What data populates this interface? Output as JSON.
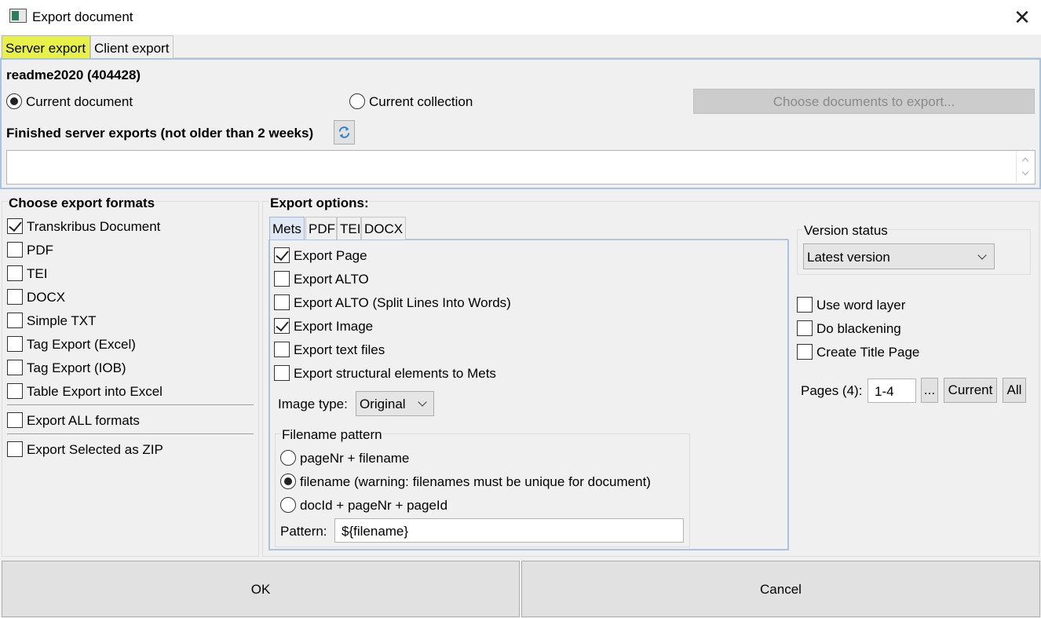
{
  "window": {
    "title": "Export document",
    "close_glyph": "✕"
  },
  "main_tabs": [
    {
      "label": "Server export"
    },
    {
      "label": "Client export"
    }
  ],
  "server": {
    "doc_title": "readme2020 (404428)",
    "radio_current_document": "Current document",
    "radio_current_collection": "Current collection",
    "choose_docs_button": "Choose documents to export...",
    "finished_label": "Finished server exports (not older than 2 weeks)"
  },
  "formats": {
    "heading": "Choose export formats",
    "items": [
      {
        "label": "Transkribus Document",
        "checked": true
      },
      {
        "label": "PDF",
        "checked": false
      },
      {
        "label": "TEI",
        "checked": false
      },
      {
        "label": "DOCX",
        "checked": false
      },
      {
        "label": "Simple TXT",
        "checked": false
      },
      {
        "label": "Tag Export (Excel)",
        "checked": false
      },
      {
        "label": "Tag Export (IOB)",
        "checked": false
      },
      {
        "label": "Table Export into Excel",
        "checked": false
      }
    ],
    "export_all": "Export ALL formats",
    "export_zip": "Export Selected as ZIP"
  },
  "options": {
    "heading": "Export options:",
    "tabs": [
      "Mets",
      "PDF",
      "TEI",
      "DOCX"
    ],
    "items": [
      {
        "label": "Export Page",
        "checked": true
      },
      {
        "label": "Export ALTO",
        "checked": false
      },
      {
        "label": "Export ALTO (Split Lines Into Words)",
        "checked": false
      },
      {
        "label": "Export Image",
        "checked": true
      },
      {
        "label": "Export text files",
        "checked": false
      },
      {
        "label": "Export structural elements to Mets",
        "checked": false
      }
    ],
    "image_type_label": "Image type:",
    "image_type_value": "Original",
    "filename_group": "Filename pattern",
    "filename_options": [
      {
        "label": "pageNr + filename",
        "selected": false
      },
      {
        "label": "filename (warning: filenames must be unique for document)",
        "selected": true
      },
      {
        "label": "docId + pageNr + pageId",
        "selected": false
      }
    ],
    "pattern_label": "Pattern:",
    "pattern_value": "${filename}"
  },
  "right": {
    "version_group": "Version status",
    "version_value": "Latest version",
    "checks": [
      {
        "label": "Use word layer",
        "checked": false
      },
      {
        "label": "Do blackening",
        "checked": false
      },
      {
        "label": "Create Title Page",
        "checked": false
      }
    ],
    "pages_label": "Pages (4):",
    "pages_value": "1-4",
    "dots_button": "...",
    "current_button": "Current",
    "all_button": "All"
  },
  "footer": {
    "ok": "OK",
    "cancel": "Cancel"
  },
  "colors": {
    "highlight": "#e8f04a",
    "panel_border": "#a9c4e0",
    "refresh_icon": "#2a7fd4"
  }
}
